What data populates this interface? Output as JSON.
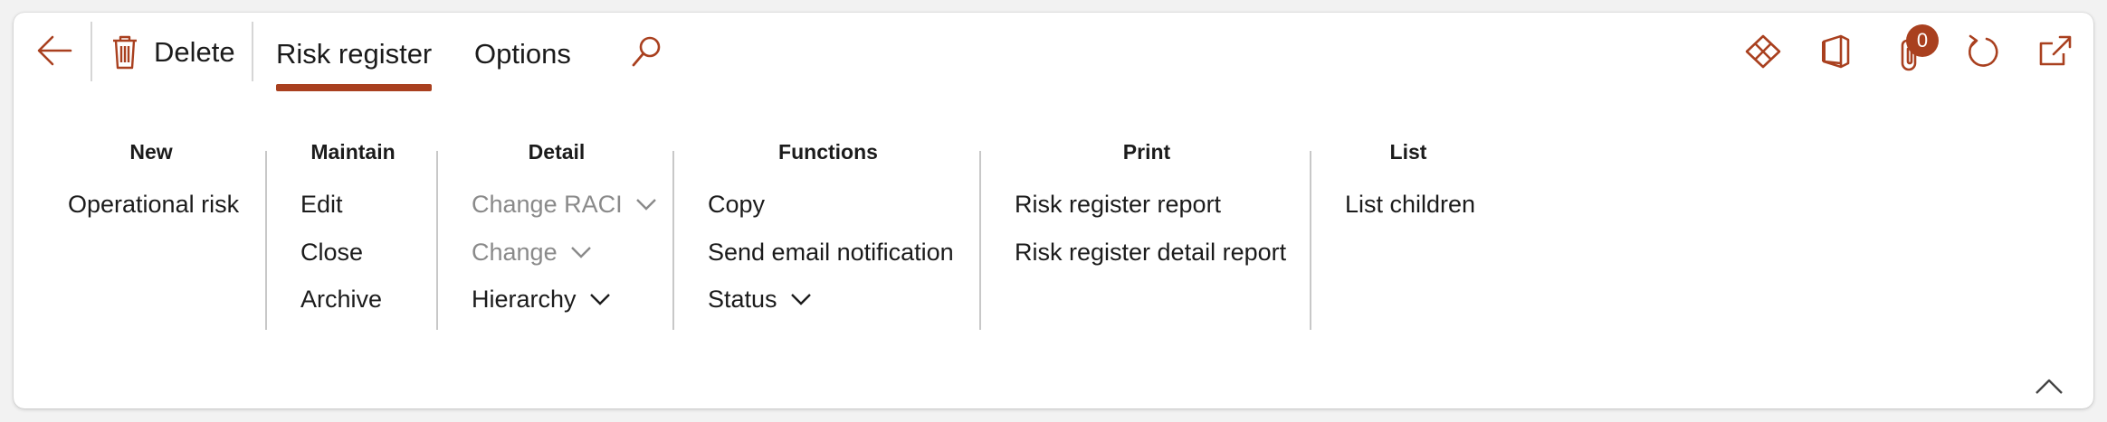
{
  "toolbar": {
    "delete_label": "Delete",
    "tabs": [
      {
        "label": "Risk register",
        "active": true
      },
      {
        "label": "Options",
        "active": false
      }
    ],
    "attachments_count": "0",
    "accent_color": "#a9401f",
    "icons": [
      "back-arrow-icon",
      "trash-icon",
      "search-icon",
      "power-apps-icon",
      "office-icon",
      "paperclip-icon",
      "refresh-icon",
      "open-new-window-icon",
      "collapse-chevron-up-icon"
    ]
  },
  "groups": {
    "new": {
      "title": "New",
      "items": [
        "Operational risk"
      ]
    },
    "maintain": {
      "title": "Maintain",
      "items": [
        "Edit",
        "Close",
        "Archive"
      ]
    },
    "detail": {
      "title": "Detail",
      "items": [
        "Change RACI",
        "Change",
        "Hierarchy"
      ]
    },
    "functions": {
      "title": "Functions",
      "items": [
        "Copy",
        "Send email notification",
        "Status"
      ]
    },
    "print": {
      "title": "Print",
      "items": [
        "Risk register report",
        "Risk register detail report"
      ]
    },
    "list": {
      "title": "List",
      "items": [
        "List children"
      ]
    }
  }
}
